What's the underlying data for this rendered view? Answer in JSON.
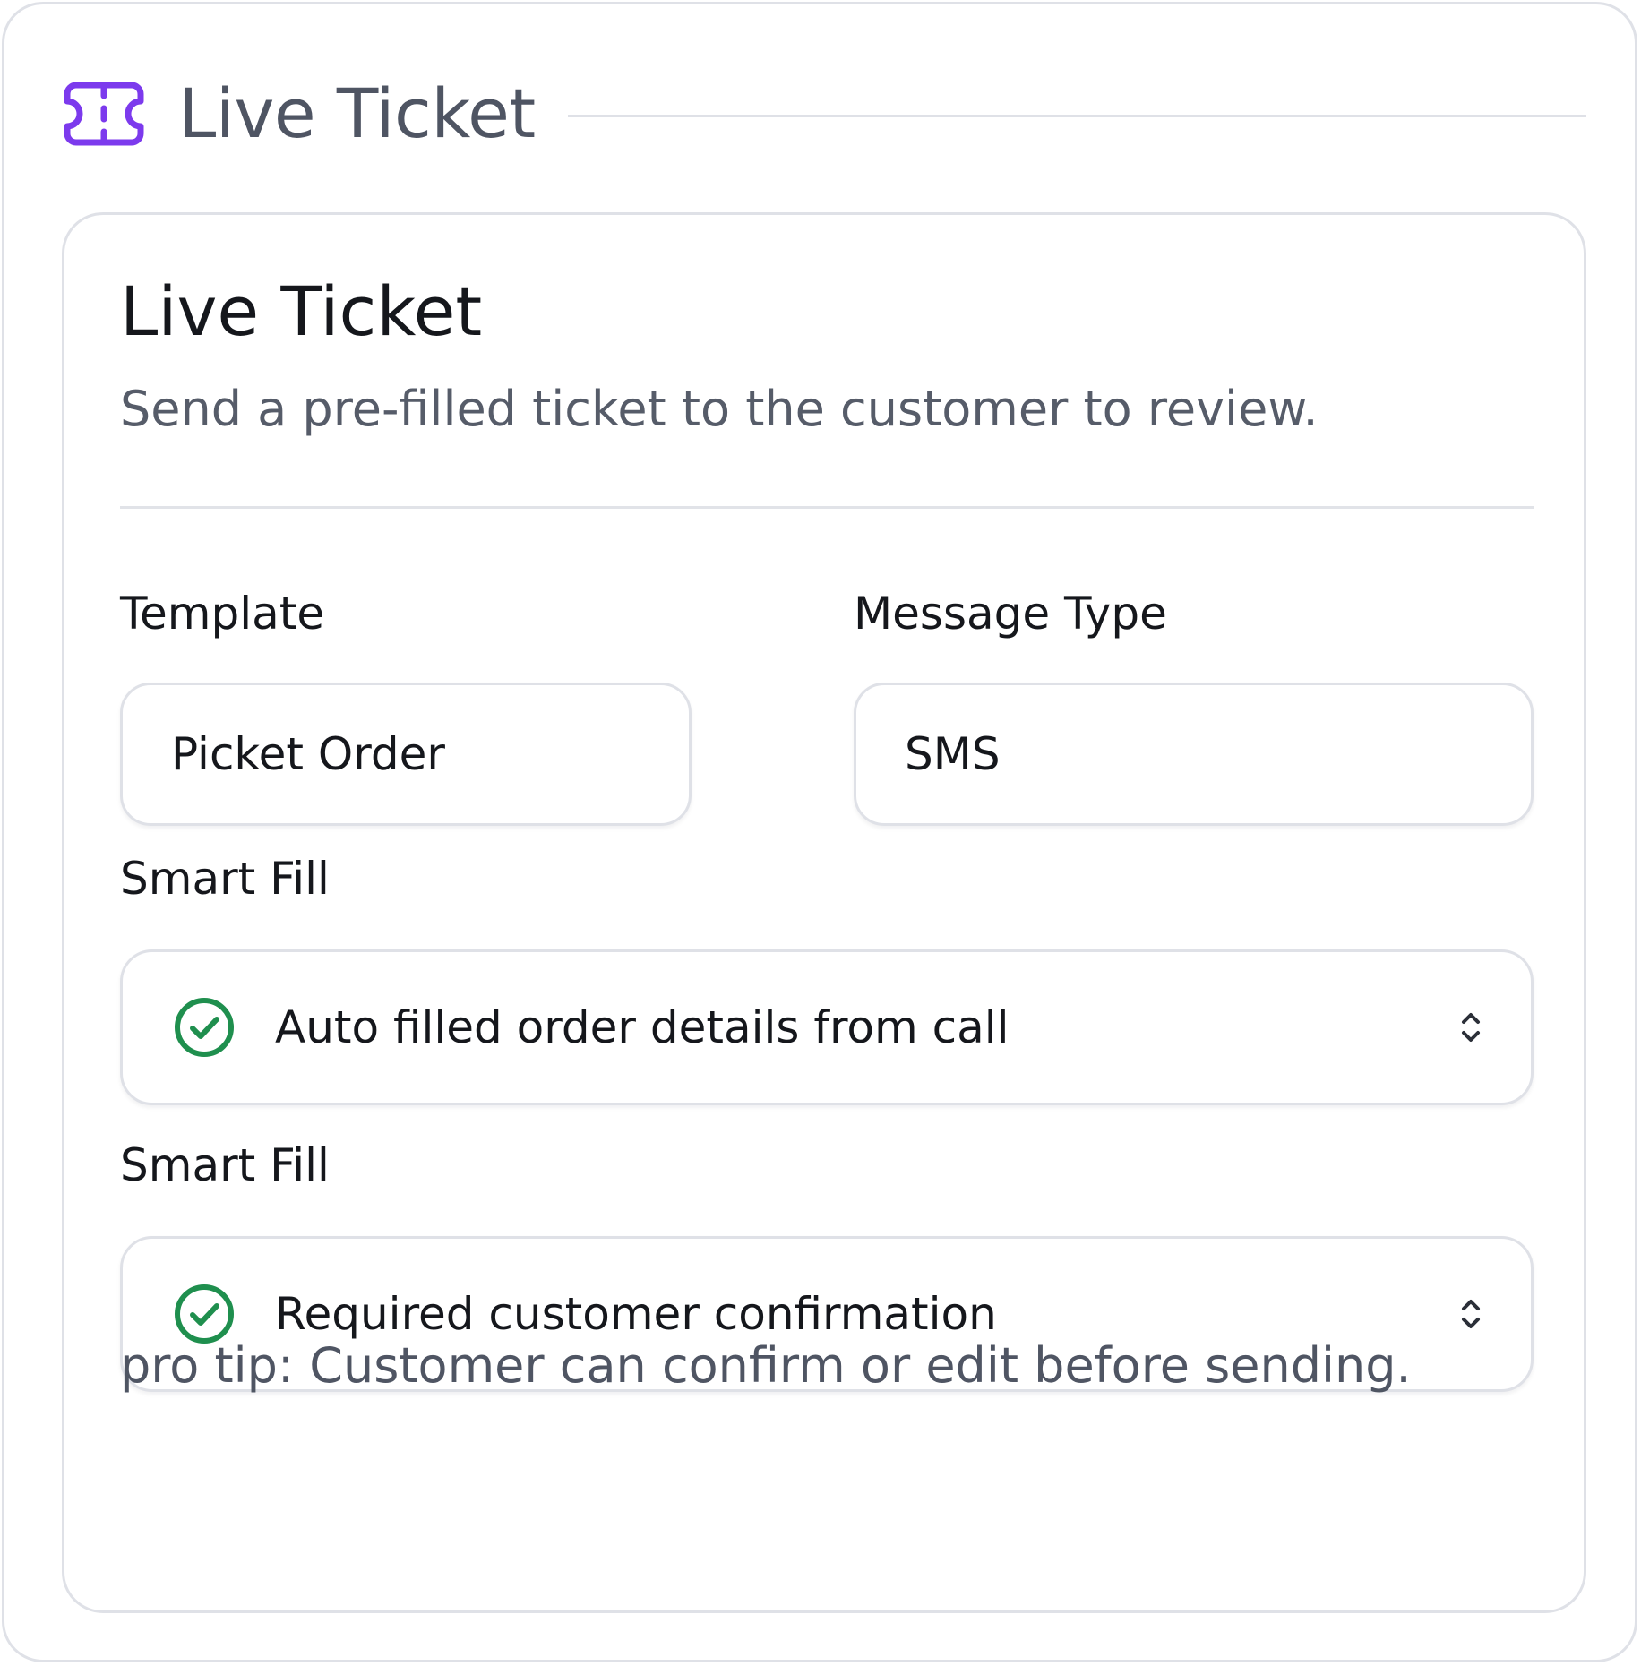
{
  "header": {
    "title": "Live Ticket",
    "icon": "ticket-icon",
    "icon_color": "#7c3aed"
  },
  "card": {
    "title": "Live Ticket",
    "subtitle": "Send a pre-filled ticket to the customer to review."
  },
  "fields": {
    "template": {
      "label": "Template",
      "value": "Picket Order"
    },
    "message_type": {
      "label": "Message Type",
      "value": "SMS"
    }
  },
  "smart_fills": [
    {
      "label": "Smart Fill",
      "value": "Auto filled order details from call",
      "icon": "check-circle-icon",
      "chevron": "chevron-up-down-icon"
    },
    {
      "label": "Smart Fill",
      "value": "Required customer confirmation",
      "icon": "check-circle-icon",
      "chevron": "chevron-up-down-icon"
    }
  ],
  "pro_tip": "pro tip: Customer can confirm or edit before sending.",
  "colors": {
    "accent": "#7c3aed",
    "success": "#1f8f4e",
    "border": "#dfe1e7"
  }
}
